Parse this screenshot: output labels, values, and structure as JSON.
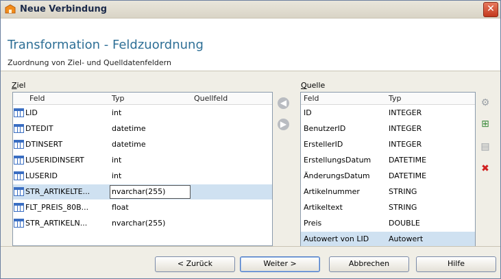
{
  "window": {
    "title": "Neue Verbindung",
    "close_glyph": "✕"
  },
  "header": {
    "title": "Transformation - Feldzuordnung",
    "subtitle": "Zuordnung von Ziel- und Quelldatenfeldern"
  },
  "target": {
    "label_prefix": "Z",
    "label_rest": "iel",
    "columns": [
      "Feld",
      "Typ",
      "Quellfeld"
    ],
    "rows": [
      {
        "feld": "LID",
        "typ": "int",
        "quellfeld": ""
      },
      {
        "feld": "DTEDIT",
        "typ": "datetime",
        "quellfeld": ""
      },
      {
        "feld": "DTINSERT",
        "typ": "datetime",
        "quellfeld": ""
      },
      {
        "feld": "LUSERIDINSERT",
        "typ": "int",
        "quellfeld": ""
      },
      {
        "feld": "LUSERID",
        "typ": "int",
        "quellfeld": ""
      },
      {
        "feld": "STR_ARTIKELTE...",
        "typ": "nvarchar(255)",
        "quellfeld": ""
      },
      {
        "feld": "FLT_PREIS_80B...",
        "typ": "float",
        "quellfeld": ""
      },
      {
        "feld": "STR_ARTIKELN...",
        "typ": "nvarchar(255)",
        "quellfeld": ""
      }
    ],
    "selected_index": 5
  },
  "source": {
    "label_prefix": "Q",
    "label_rest": "uelle",
    "columns": [
      "Feld",
      "Typ"
    ],
    "rows": [
      {
        "feld": "ID",
        "typ": "INTEGER"
      },
      {
        "feld": "BenutzerID",
        "typ": "INTEGER"
      },
      {
        "feld": "ErstellerID",
        "typ": "INTEGER"
      },
      {
        "feld": "ErstellungsDatum",
        "typ": "DATETIME"
      },
      {
        "feld": "ÄnderungsDatum",
        "typ": "DATETIME"
      },
      {
        "feld": "Artikelnummer",
        "typ": "STRING"
      },
      {
        "feld": "Artikeltext",
        "typ": "STRING"
      },
      {
        "feld": "Preis",
        "typ": "DOUBLE"
      },
      {
        "feld": "Autowert von LID",
        "typ": "Autowert"
      }
    ],
    "selected_index": 8
  },
  "mapping_buttons": {
    "assign_glyph": "◀",
    "remove_glyph": "▶"
  },
  "side_buttons": [
    {
      "name": "gear-icon",
      "glyph": "⚙",
      "color": "#9aa0a6"
    },
    {
      "name": "add-field-icon",
      "glyph": "⊞",
      "color": "#3a8a3a"
    },
    {
      "name": "document-icon",
      "glyph": "▤",
      "color": "#9aa0a6"
    },
    {
      "name": "delete-icon",
      "glyph": "✖",
      "color": "#d02020"
    }
  ],
  "footer": {
    "back": "< Zurück",
    "next": "Weiter >",
    "cancel": "Abbrechen",
    "help": "Hilfe"
  }
}
